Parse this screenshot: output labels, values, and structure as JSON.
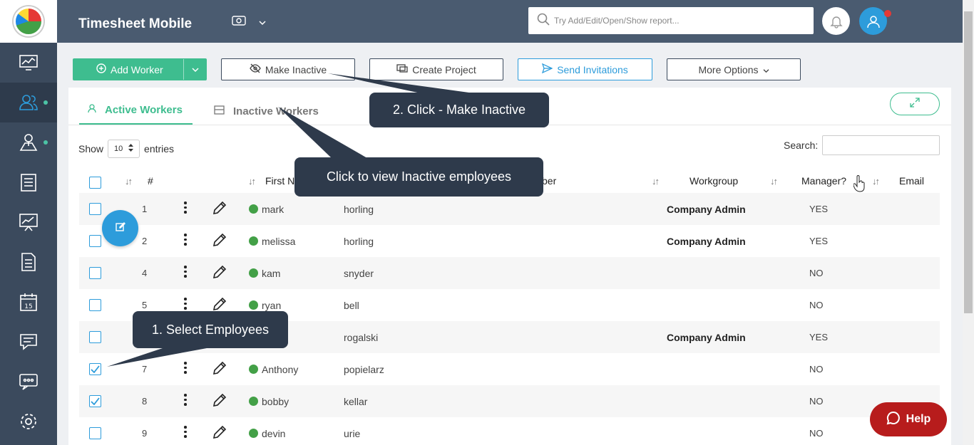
{
  "app": {
    "title": "Timesheet Mobile"
  },
  "header": {
    "search_placeholder": "Try Add/Edit/Open/Show report..."
  },
  "toolbar": {
    "add_worker": "Add Worker",
    "make_inactive": "Make Inactive",
    "create_project": "Create Project",
    "send_invitations": "Send Invitations",
    "more_options": "More Options"
  },
  "tabs": {
    "active": "Active Workers",
    "inactive": "Inactive Workers"
  },
  "table_controls": {
    "show": "Show",
    "entries_value": "10",
    "entries": "entries",
    "search": "Search:"
  },
  "columns": {
    "num": "#",
    "first_name": "First N",
    "number": "ber",
    "workgroup": "Workgroup",
    "manager": "Manager?",
    "email": "Email"
  },
  "rows": [
    {
      "num": "1",
      "first": "mark",
      "last": "horling",
      "workgroup": "Company Admin",
      "manager": "YES",
      "checked": false
    },
    {
      "num": "2",
      "first": "melissa",
      "last": "horling",
      "workgroup": "Company Admin",
      "manager": "YES",
      "checked": false
    },
    {
      "num": "4",
      "first": "kam",
      "last": "snyder",
      "workgroup": "",
      "manager": "NO",
      "checked": false
    },
    {
      "num": "5",
      "first": "ryan",
      "last": "bell",
      "workgroup": "",
      "manager": "NO",
      "checked": false
    },
    {
      "num": "",
      "first": "ntha",
      "last": "rogalski",
      "workgroup": "Company Admin",
      "manager": "YES",
      "checked": false
    },
    {
      "num": "7",
      "first": "Anthony",
      "last": "popielarz",
      "workgroup": "",
      "manager": "NO",
      "checked": true
    },
    {
      "num": "8",
      "first": "bobby",
      "last": "kellar",
      "workgroup": "",
      "manager": "NO",
      "checked": true
    },
    {
      "num": "9",
      "first": "devin",
      "last": "urie",
      "workgroup": "",
      "manager": "NO",
      "checked": false
    }
  ],
  "callouts": {
    "select": "1. Select Employees",
    "make_inactive": "2. Click - Make Inactive",
    "view_inactive": "Click to view Inactive employees"
  },
  "help": {
    "label": "Help"
  },
  "colors": {
    "sidebar": "#3b4a5d",
    "header": "#4a5b70",
    "accent_green": "#3ebd8f",
    "accent_blue": "#2d9cdb",
    "help_red": "#b71c1c"
  }
}
